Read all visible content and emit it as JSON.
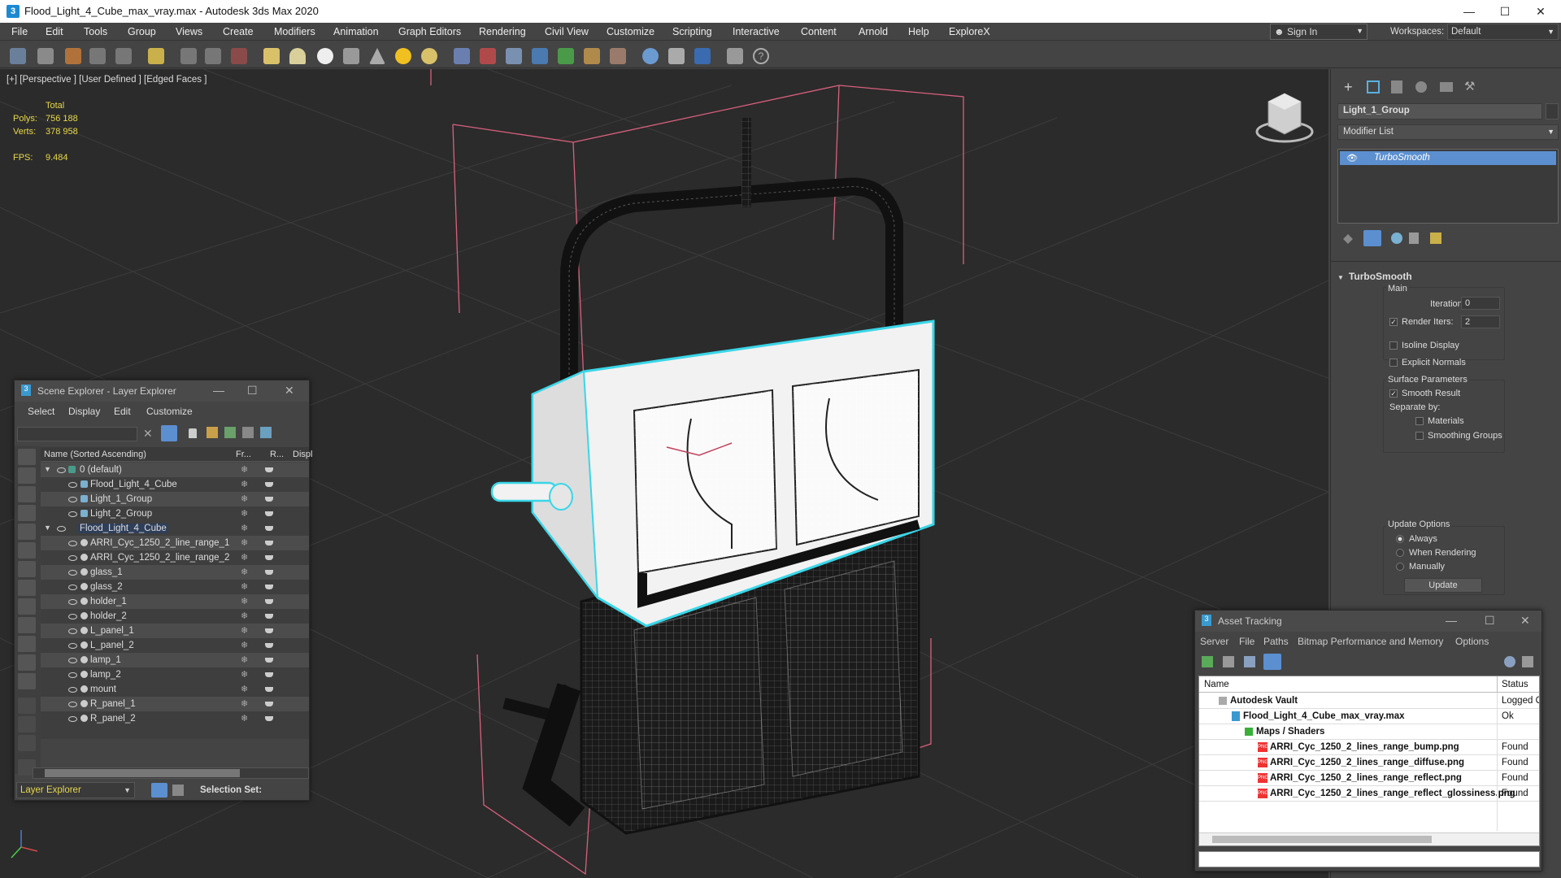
{
  "window": {
    "title": "Flood_Light_4_Cube_max_vray.max - Autodesk 3ds Max 2020"
  },
  "menu": [
    "File",
    "Edit",
    "Tools",
    "Group",
    "Views",
    "Create",
    "Modifiers",
    "Animation",
    "Graph Editors",
    "Rendering",
    "Civil View",
    "Customize",
    "Scripting",
    "Interactive",
    "Content",
    "Arnold",
    "Help",
    "ExploreX"
  ],
  "signin": "Sign In",
  "workspaces": {
    "label": "Workspaces:",
    "value": "Default"
  },
  "viewport": {
    "label": "[+] [Perspective ] [User Defined ] [Edged Faces ]",
    "stats": {
      "total_label": "Total",
      "polys_label": "Polys:",
      "polys": "756 188",
      "verts_label": "Verts:",
      "verts": "378 958",
      "fps_label": "FPS:",
      "fps": "9.484"
    }
  },
  "command_panel": {
    "object_name": "Light_1_Group",
    "modifier_list": "Modifier List",
    "stack_item": "TurboSmooth",
    "rollout": "TurboSmooth",
    "main": "Main",
    "iterations_label": "Iterations:",
    "iterations": "0",
    "render_iters_label": "Render Iters:",
    "render_iters": "2",
    "isoline": "Isoline Display",
    "explicit_normals": "Explicit Normals",
    "surface_params": "Surface Parameters",
    "smooth_result": "Smooth Result",
    "separate_by": "Separate by:",
    "materials": "Materials",
    "smoothing_groups": "Smoothing Groups",
    "update_options": "Update Options",
    "always": "Always",
    "when_rendering": "When Rendering",
    "manually": "Manually",
    "update_btn": "Update"
  },
  "scene_explorer": {
    "title": "Scene Explorer - Layer Explorer",
    "menu": [
      "Select",
      "Display",
      "Edit",
      "Customize"
    ],
    "col_name": "Name (Sorted Ascending)",
    "col_fr": "Fr...",
    "col_r": "R...",
    "col_disp": "Displ",
    "rows": [
      {
        "name": "0 (default)",
        "indent": 0,
        "kind": "layer"
      },
      {
        "name": "Flood_Light_4_Cube",
        "indent": 1,
        "kind": "group"
      },
      {
        "name": "Light_1_Group",
        "indent": 1,
        "kind": "group"
      },
      {
        "name": "Light_2_Group",
        "indent": 1,
        "kind": "group"
      },
      {
        "name": "Flood_Light_4_Cube",
        "indent": 0,
        "kind": "layer2"
      },
      {
        "name": "ARRI_Cyc_1250_2_line_range_1",
        "indent": 1,
        "kind": "obj"
      },
      {
        "name": "ARRI_Cyc_1250_2_line_range_2",
        "indent": 1,
        "kind": "obj"
      },
      {
        "name": "glass_1",
        "indent": 1,
        "kind": "obj"
      },
      {
        "name": "glass_2",
        "indent": 1,
        "kind": "obj"
      },
      {
        "name": "holder_1",
        "indent": 1,
        "kind": "obj"
      },
      {
        "name": "holder_2",
        "indent": 1,
        "kind": "obj"
      },
      {
        "name": "L_panel_1",
        "indent": 1,
        "kind": "obj"
      },
      {
        "name": "L_panel_2",
        "indent": 1,
        "kind": "obj"
      },
      {
        "name": "lamp_1",
        "indent": 1,
        "kind": "obj"
      },
      {
        "name": "lamp_2",
        "indent": 1,
        "kind": "obj"
      },
      {
        "name": "mount",
        "indent": 1,
        "kind": "obj"
      },
      {
        "name": "R_panel_1",
        "indent": 1,
        "kind": "obj"
      },
      {
        "name": "R_panel_2",
        "indent": 1,
        "kind": "obj"
      }
    ],
    "footer_label": "Layer Explorer",
    "selection_set": "Selection Set:"
  },
  "asset_tracking": {
    "title": "Asset Tracking",
    "menu": [
      "Server",
      "File",
      "Paths",
      "Bitmap Performance and Memory",
      "Options"
    ],
    "col_name": "Name",
    "col_status": "Status",
    "rows": [
      {
        "name": "Autodesk Vault",
        "status": "Logged O",
        "level": 1,
        "icon": "vault"
      },
      {
        "name": "Flood_Light_4_Cube_max_vray.max",
        "status": "Ok",
        "level": 2,
        "icon": "max"
      },
      {
        "name": "Maps / Shaders",
        "status": "",
        "level": 3,
        "icon": "maps"
      },
      {
        "name": "ARRI_Cyc_1250_2_lines_range_bump.png",
        "status": "Found",
        "level": 4,
        "icon": "png"
      },
      {
        "name": "ARRI_Cyc_1250_2_lines_range_diffuse.png",
        "status": "Found",
        "level": 4,
        "icon": "png"
      },
      {
        "name": "ARRI_Cyc_1250_2_lines_range_reflect.png",
        "status": "Found",
        "level": 4,
        "icon": "png"
      },
      {
        "name": "ARRI_Cyc_1250_2_lines_range_reflect_glossiness.png",
        "status": "Found",
        "level": 4,
        "icon": "png"
      }
    ]
  },
  "colors": {
    "selection_cyan": "#3ad6e8",
    "bbox_pink": "#d9607e",
    "stats_yellow": "#e8d84a",
    "highlight_blue": "#5b8fd0"
  }
}
